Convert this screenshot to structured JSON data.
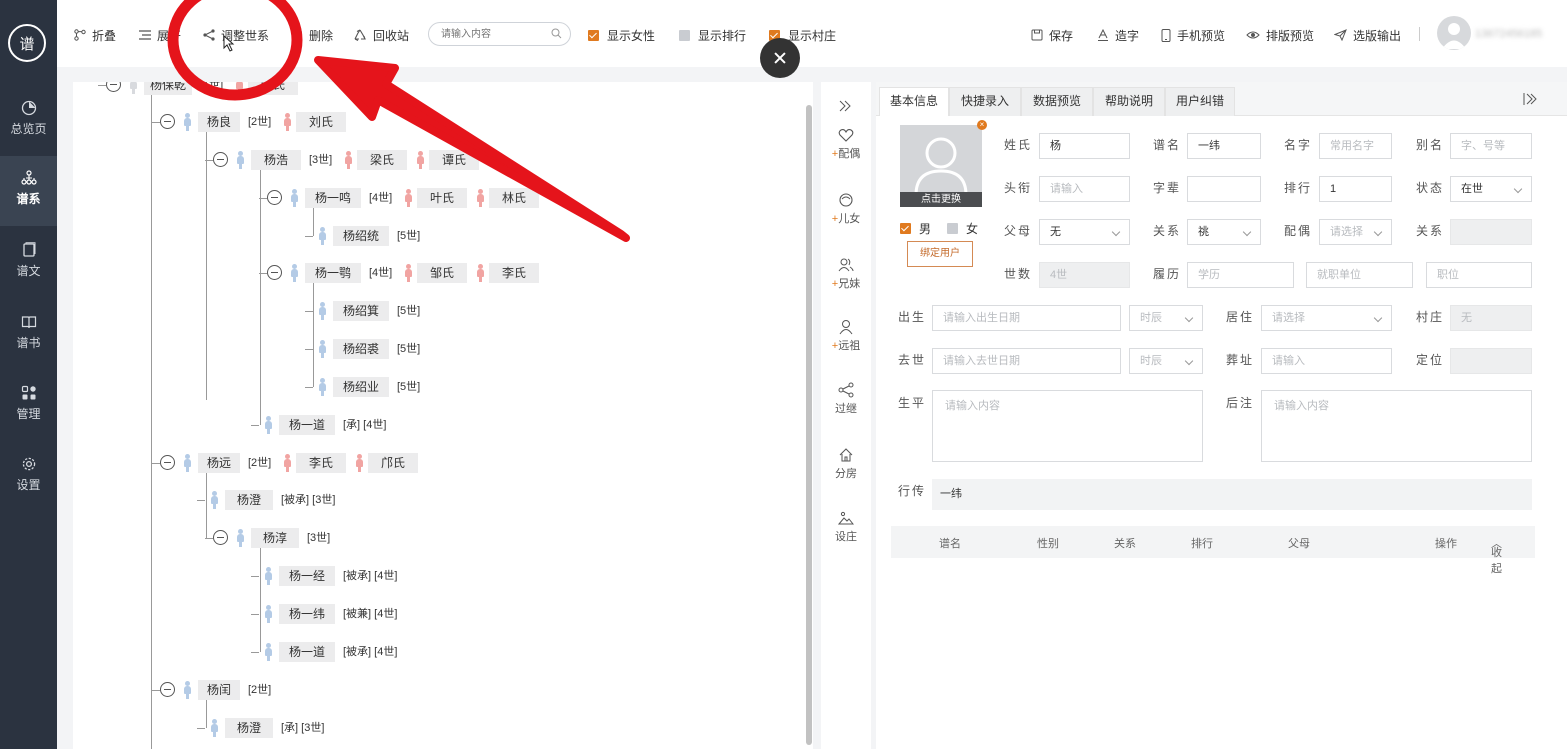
{
  "app": {
    "logo_text": "谱"
  },
  "sidebar": {
    "items": [
      {
        "label": "总览页",
        "icon": "pie-chart-icon"
      },
      {
        "label": "谱系",
        "icon": "tree-icon"
      },
      {
        "label": "谱文",
        "icon": "document-icon"
      },
      {
        "label": "谱书",
        "icon": "book-icon"
      },
      {
        "label": "管理",
        "icon": "grid-icon"
      },
      {
        "label": "设置",
        "icon": "gear-icon"
      }
    ]
  },
  "toolbar": {
    "collapse": "折叠",
    "expand": "展开",
    "adjust": "调整世系",
    "delete": "删除",
    "recycle": "回收站",
    "search_placeholder": "请输入内容",
    "show_female": "显示女性",
    "show_rank": "显示排行",
    "show_village": "显示村庄",
    "save": "保存",
    "make_char": "造字",
    "mobile_preview": "手机预览",
    "layout_preview": "排版预览",
    "export": "选版输出",
    "user_phone": "13672456185"
  },
  "tree": {
    "nodes": [
      {
        "name": "杨保乾",
        "gen": "[1世]",
        "spouses": [
          "许氏"
        ]
      },
      {
        "name": "杨良",
        "gen": "[2世]",
        "spouses": [
          "刘氏"
        ]
      },
      {
        "name": "杨浩",
        "gen": "[3世]",
        "spouses": [
          "梁氏",
          "谭氏"
        ]
      },
      {
        "name": "杨一鸣",
        "gen": "[4世]",
        "spouses": [
          "叶氏",
          "林氏"
        ]
      },
      {
        "name": "杨绍统",
        "gen": "[5世]",
        "spouses": []
      },
      {
        "name": "杨一鹗",
        "gen": "[4世]",
        "spouses": [
          "邹氏",
          "李氏"
        ]
      },
      {
        "name": "杨绍箕",
        "gen": "[5世]",
        "spouses": []
      },
      {
        "name": "杨绍裘",
        "gen": "[5世]",
        "spouses": []
      },
      {
        "name": "杨绍业",
        "gen": "[5世]",
        "spouses": []
      },
      {
        "name": "杨一道",
        "gen": "[承] [4世]",
        "spouses": []
      },
      {
        "name": "杨远",
        "gen": "[2世]",
        "spouses": [
          "李氏",
          "邝氏"
        ]
      },
      {
        "name": "杨澄",
        "gen": "[被承] [3世]",
        "spouses": []
      },
      {
        "name": "杨淳",
        "gen": "[3世]",
        "spouses": []
      },
      {
        "name": "杨一经",
        "gen": "[被承] [4世]",
        "spouses": []
      },
      {
        "name": "杨一纬",
        "gen": "[被兼] [4世]",
        "spouses": []
      },
      {
        "name": "杨一道",
        "gen": "[被承] [4世]",
        "spouses": []
      },
      {
        "name": "杨闰",
        "gen": "[2世]",
        "spouses": []
      },
      {
        "name": "杨澄",
        "gen": "[承] [3世]",
        "spouses": []
      }
    ]
  },
  "relations": {
    "items": [
      {
        "label": "配偶",
        "plus": "+"
      },
      {
        "label": "儿女",
        "plus": "+"
      },
      {
        "label": "兄妹",
        "plus": "+"
      },
      {
        "label": "远祖",
        "plus": "+"
      },
      {
        "label": "过继",
        "plus": ""
      },
      {
        "label": "分房",
        "plus": ""
      },
      {
        "label": "设庄",
        "plus": ""
      }
    ]
  },
  "panel": {
    "tabs": [
      "基本信息",
      "快捷录入",
      "数据预览",
      "帮助说明",
      "用户纠错"
    ],
    "photo_change": "点击更换",
    "male": "男",
    "female": "女",
    "bind_user": "绑定用户",
    "labels": {
      "surname": "姓氏",
      "pu_name": "谱名",
      "given_name": "名字",
      "alias": "别名",
      "title": "头衔",
      "zi_bei": "字辈",
      "rank": "排行",
      "status": "状态",
      "parents": "父母",
      "relation": "关系",
      "spouse": "配偶",
      "relation2": "关系",
      "generation": "世数",
      "resume": "履历",
      "birth": "出生",
      "residence": "居住",
      "village": "村庄",
      "death": "去世",
      "burial": "葬址",
      "location": "定位",
      "life": "生平",
      "note": "后注",
      "xing_zhuan": "行传"
    },
    "values": {
      "surname": "杨",
      "pu_name": "一纬",
      "given_name_ph": "常用名字",
      "alias_ph": "字、号等",
      "title_ph": "请输入",
      "zi_bei": "",
      "rank": "1",
      "status": "在世",
      "parents": "无",
      "relation": "祧",
      "spouse_ph": "请选择",
      "relation2": "",
      "generation": "4世",
      "resume_ph": "学历",
      "work_ph": "就职单位",
      "position_ph": "职位",
      "birth_ph": "请输入出生日期",
      "time_ph": "时辰",
      "residence_ph": "请选择",
      "village": "无",
      "death_ph": "请输入去世日期",
      "death_time_ph": "时辰",
      "burial_ph": "请输入",
      "life_ph": "请输入内容",
      "note_ph": "请输入内容",
      "xing_zhuan": "一纬"
    },
    "table_headers": [
      "谱名",
      "性别",
      "关系",
      "排行",
      "父母",
      "操作"
    ],
    "collapse": "收起"
  },
  "colors": {
    "sidebar": "#2b3340",
    "accent": "#e07a1f",
    "male": "#b4cbe6",
    "female": "#f1a4a2",
    "annotation_red": "#e5141b"
  }
}
